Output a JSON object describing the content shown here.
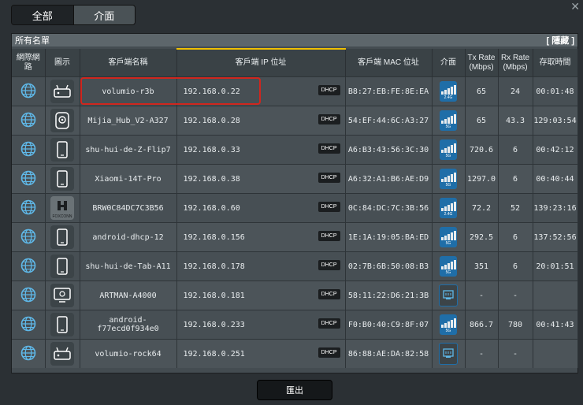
{
  "tabs": [
    {
      "label": "全部"
    },
    {
      "label": "介面"
    }
  ],
  "panel": {
    "title": "所有名單",
    "hide_label": "[ 隱藏 ]"
  },
  "columns": [
    "網際網路",
    "圖示",
    "客戶端名稱",
    "客戶端 IP 位址",
    "客戶端 MAC 位址",
    "介面",
    "Tx Rate (Mbps)",
    "Rx Rate (Mbps)",
    "存取時間"
  ],
  "rows": [
    {
      "icon": "router-icon",
      "name": "volumio-r3b",
      "ip": "192.168.0.22",
      "dhcp": "DHCP",
      "mac": "B8:27:EB:FE:8E:EA",
      "iface": "wifi-2.4G",
      "band": "2.4G",
      "tx": "65",
      "rx": "24",
      "time": "00:01:48"
    },
    {
      "icon": "camera-icon",
      "name": "Mijia_Hub_V2-A327",
      "ip": "192.168.0.28",
      "dhcp": "DHCP",
      "mac": "54:EF:44:6C:A3:27",
      "iface": "wifi-5G",
      "band": "5G",
      "tx": "65",
      "rx": "43.3",
      "time": "129:03:54"
    },
    {
      "icon": "phone-icon",
      "name": "shu-hui-de-Z-Flip7",
      "ip": "192.168.0.33",
      "dhcp": "DHCP",
      "mac": "A6:B3:43:56:3C:30",
      "iface": "wifi-5G",
      "band": "5G",
      "tx": "720.6",
      "rx": "6",
      "time": "00:42:12"
    },
    {
      "icon": "phone-icon",
      "name": "Xiaomi-14T-Pro",
      "ip": "192.168.0.38",
      "dhcp": "DHCP",
      "mac": "A6:32:A1:B6:AE:D9",
      "iface": "wifi-5G",
      "band": "5G",
      "tx": "1297.0",
      "rx": "6",
      "time": "00:40:44"
    },
    {
      "icon": "foxconn-icon",
      "name": "BRW0C84DC7C3B56",
      "ip": "192.168.0.60",
      "dhcp": "DHCP",
      "mac": "0C:84:DC:7C:3B:56",
      "iface": "wifi-2.4G",
      "band": "2.4G",
      "tx": "72.2",
      "rx": "52",
      "time": "139:23:16",
      "brand": "FOXCONN"
    },
    {
      "icon": "phone-icon",
      "name": "android-dhcp-12",
      "ip": "192.168.0.156",
      "dhcp": "DHCP",
      "mac": "1E:1A:19:05:BA:ED",
      "iface": "wifi-5G",
      "band": "5G",
      "tx": "292.5",
      "rx": "6",
      "time": "137:52:56"
    },
    {
      "icon": "phone-icon",
      "name": "shu-hui-de-Tab-A11",
      "ip": "192.168.0.178",
      "dhcp": "DHCP",
      "mac": "02:7B:6B:50:08:B3",
      "iface": "wifi-5G",
      "band": "5G",
      "tx": "351",
      "rx": "6",
      "time": "20:01:51"
    },
    {
      "icon": "monitor-icon",
      "name": "ARTMAN-A4000",
      "ip": "192.168.0.181",
      "dhcp": "DHCP",
      "mac": "58:11:22:D6:21:3B",
      "iface": "ethernet",
      "band": "",
      "tx": "-",
      "rx": "-",
      "time": ""
    },
    {
      "icon": "phone-icon",
      "name": "android-f77ecd0f934e0",
      "ip": "192.168.0.233",
      "dhcp": "DHCP",
      "mac": "F0:B0:40:C9:8F:07",
      "iface": "wifi-5G",
      "band": "5G",
      "tx": "866.7",
      "rx": "780",
      "time": "00:41:43"
    },
    {
      "icon": "router-icon",
      "name": "volumio-rock64",
      "ip": "192.168.0.251",
      "dhcp": "DHCP",
      "mac": "86:88:AE:DA:82:58",
      "iface": "ethernet",
      "band": "",
      "tx": "-",
      "rx": "-",
      "time": ""
    }
  ],
  "export_label": "匯出",
  "colors": {
    "highlight_border": "#d0261e",
    "header_accent": "#f0c000",
    "wifi_blue": "#1f6ea8"
  }
}
